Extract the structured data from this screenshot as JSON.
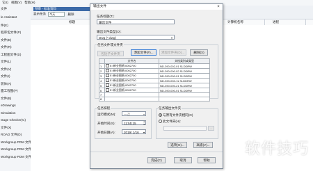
{
  "menubar": {
    "items": [
      "它(I)",
      "视图(V)",
      "帮助(H)"
    ]
  },
  "sidebar": {
    "items": [
      "文件",
      "le Assistant",
      "件(E)",
      "程序包文件(P)",
      "文件(E)",
      "文件(R)",
      "工程图文件(D)",
      "文件(L)",
      "文件(V)",
      "文件(I)",
      "装体(A)",
      "面工程图(P)",
      "文件(B)",
      "eDrawings",
      "Simulation",
      "Gage Checker(C)",
      "文件(X)",
      "ROAD 文件(D)",
      "Workgroup PDM 文件",
      "Workgroup PDM 文件",
      "Workgroup PDM 文件"
    ]
  },
  "background": {
    "task_title": "预审 - 标准资料",
    "show_label": "显示任务",
    "show_value": "今天",
    "delete_label": "删除",
    "col_name": "标题",
    "col_computer": "计算机名称",
    "col_progress": "进程"
  },
  "dialog": {
    "title": "输出文件",
    "close_glyph": "×",
    "task_name_label": "任务标题(T):",
    "task_name_value": "输出文件",
    "output_type_label": "输出文件类型(O):",
    "output_type_value": "Dwg (*.dwg)",
    "file_group_label": "任务文件或文件夹",
    "btn_include_sub": "包括子文件夹",
    "btn_add_file": "添加文件(F)...",
    "btn_add_folder": "添加文件夹(D)...",
    "btn_delete": "删除(X)",
    "col_filename": "文件名",
    "col_filetype": "文档类别或类型",
    "files": [
      {
        "name": "E:\\新业图纸\\0002700",
        "type": "ND-390-002-01 SLDDRW"
      },
      {
        "name": "E:\\新业图纸\\0002700",
        "type": "ND-390-000-02 SLDDRW"
      },
      {
        "name": "E:\\新业图纸\\0002700",
        "type": "ND-390-000-01 SLDDRW"
      },
      {
        "name": "E:\\新业图纸\\0002700",
        "type": "ND-390-000-11 SLDDRW"
      },
      {
        "name": "E:\\新业图纸\\0002700",
        "type": "ND-390-000-21 SLDDRW"
      },
      {
        "name": "E:\\新业图纸\\0002700",
        "type": "ND-390-000-01 SLDDRW"
      }
    ],
    "row_numbers": [
      "1",
      "2",
      "3",
      "4",
      "5",
      "6",
      "7",
      "8"
    ],
    "schedule_label": "任务排程",
    "run_mode_label": "运行模式(M):",
    "run_mode_value": "一次",
    "start_time_label": "开始时间(S):",
    "start_time_value": "11:55:15",
    "start_date_label": "开始日期(A):",
    "start_date_value": "2019/ 1/16",
    "output_folder_label": "任务输出文件夹",
    "radio_same": "与原有文件夹相同(O)",
    "radio_this": "此文件夹(H):",
    "browse_glyph": "...",
    "btn_options": "选项(O)...",
    "btn_advanced": "高级(V)...",
    "btn_finish": "完成(C)",
    "btn_cancel": "取消",
    "btn_help": "帮助"
  },
  "watermark": "软件技巧"
}
